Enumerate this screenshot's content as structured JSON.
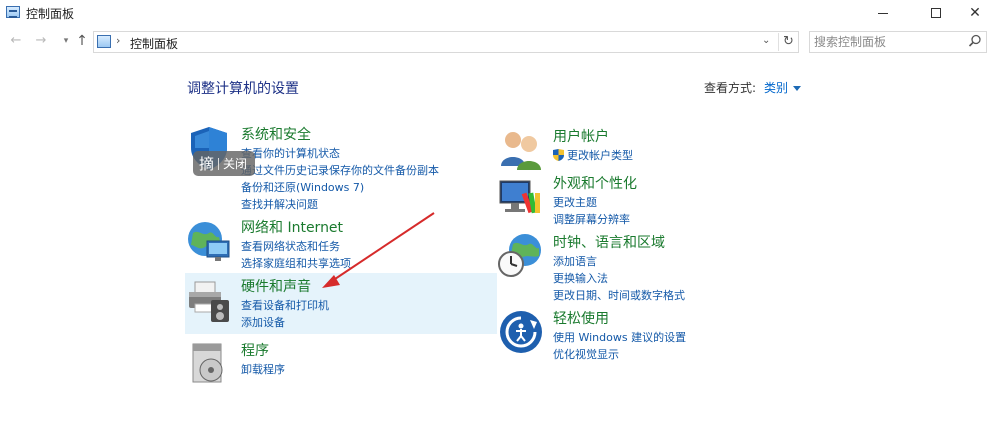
{
  "window": {
    "title": "控制面板"
  },
  "nav": {
    "breadcrumb": "控制面板",
    "search_placeholder": "搜索控制面板"
  },
  "main": {
    "heading": "调整计算机的设置",
    "view_by_label": "查看方式:",
    "view_by_value": "类别"
  },
  "overlay": {
    "left": "摘",
    "right": "关闭"
  },
  "categories": [
    {
      "title": "系统和安全",
      "links": [
        "查看你的计算机状态",
        "通过文件历史记录保存你的文件备份副本",
        "备份和还原(Windows 7)",
        "查找并解决问题"
      ]
    },
    {
      "title": "网络和 Internet",
      "links": [
        "查看网络状态和任务",
        "选择家庭组和共享选项"
      ]
    },
    {
      "title": "硬件和声音",
      "links": [
        "查看设备和打印机",
        "添加设备"
      ]
    },
    {
      "title": "程序",
      "links": [
        "卸载程序"
      ]
    },
    {
      "title": "用户帐户",
      "links": [
        "更改帐户类型"
      ]
    },
    {
      "title": "外观和个性化",
      "links": [
        "更改主题",
        "调整屏幕分辨率"
      ]
    },
    {
      "title": "时钟、语言和区域",
      "links": [
        "添加语言",
        "更换输入法",
        "更改日期、时间或数字格式"
      ]
    },
    {
      "title": "轻松使用",
      "links": [
        "使用 Windows 建议的设置",
        "优化视觉显示"
      ]
    }
  ],
  "colors": {
    "accent": "#1459a8",
    "category_title": "#1a7a2e",
    "highlight": "#e5f3fb",
    "annotation_arrow": "#d62b2b"
  }
}
